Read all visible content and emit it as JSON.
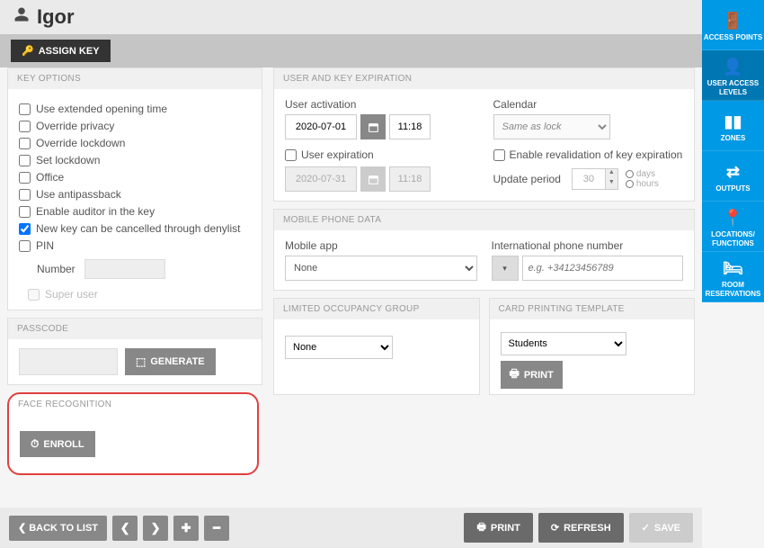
{
  "header": {
    "username": "Igor"
  },
  "toolbar": {
    "assign_key": "ASSIGN KEY"
  },
  "key_options": {
    "title": "KEY OPTIONS",
    "extended": "Use extended opening time",
    "override_privacy": "Override privacy",
    "override_lockdown": "Override lockdown",
    "set_lockdown": "Set lockdown",
    "office": "Office",
    "antipassback": "Use antipassback",
    "auditor": "Enable auditor in the key",
    "denylist": "New key can be cancelled through denylist",
    "pin": "PIN",
    "number_label": "Number",
    "super_user": "Super user"
  },
  "expiration": {
    "title": "USER AND KEY EXPIRATION",
    "user_activation": "User activation",
    "activation_date": "2020-07-01",
    "activation_time": "11:18",
    "calendar": "Calendar",
    "calendar_val": "Same as lock",
    "user_expiration": "User expiration",
    "expiration_date": "2020-07-31",
    "expiration_time": "11:18",
    "enable_revalidation": "Enable revalidation of key expiration",
    "update_period": "Update period",
    "update_value": "30",
    "days": "days",
    "hours": "hours"
  },
  "passcode": {
    "title": "PASSCODE",
    "generate": "GENERATE"
  },
  "mobile": {
    "title": "MOBILE PHONE DATA",
    "app_label": "Mobile app",
    "app_value": "None",
    "phone_label": "International phone number",
    "phone_placeholder": "e.g. +34123456789"
  },
  "face": {
    "title": "FACE RECOGNITION",
    "enroll": "ENROLL"
  },
  "limited": {
    "title": "LIMITED OCCUPANCY GROUP",
    "value": "None"
  },
  "card_template": {
    "title": "CARD PRINTING TEMPLATE",
    "value": "Students",
    "print": "PRINT"
  },
  "footer": {
    "back": "BACK TO LIST",
    "print": "PRINT",
    "refresh": "REFRESH",
    "save": "SAVE"
  },
  "sidebar": {
    "access_points": "ACCESS POINTS",
    "user_access": "USER ACCESS LEVELS",
    "zones": "ZONES",
    "outputs": "OUTPUTS",
    "locations": "LOCATIONS/ FUNCTIONS",
    "reservations": "ROOM RESERVATIONS"
  }
}
